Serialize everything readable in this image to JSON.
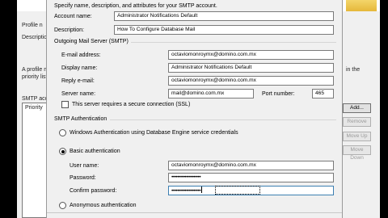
{
  "background_dialog": {
    "profile_name_label": "Profile n",
    "description_label": "Descriptio",
    "info_text_line1": "A profile m",
    "info_text_line2": "priority list",
    "info_text_right": "in the",
    "smtp_accounts_label": "SMTP acc",
    "list_header": "Priority",
    "buttons": {
      "add": "Add...",
      "remove": "Remove",
      "move_up": "Move Up",
      "move_down": "Move Down"
    }
  },
  "dialog": {
    "intro_text": "Specify name, description, and attributes for your SMTP account.",
    "account_name": {
      "label": "Account name:",
      "value": "Administrator Notifications Default"
    },
    "description": {
      "label": "Description:",
      "value": "How To Configure Database Mail"
    },
    "outgoing_section_title": "Outgoing Mail Server (SMTP)",
    "email_address": {
      "label": "E-mail address:",
      "value": "octaviomonroymx@domino.com.mx"
    },
    "display_name": {
      "label": "Display name:",
      "value": "Administrator Notifications Default"
    },
    "reply_email": {
      "label": "Reply e-mail:",
      "value": "octaviomonroymx@domino.com.mx"
    },
    "server_name": {
      "label": "Server name:",
      "value": "mail@domino.com.mx"
    },
    "port_number": {
      "label": "Port number:",
      "value": "465"
    },
    "ssl_checkbox": {
      "label": "This server requires a secure connection (SSL)",
      "checked": false
    },
    "auth_section_title": "SMTP Authentication",
    "auth_windows": {
      "label": "Windows Authentication using Database Engine service credentials",
      "selected": false
    },
    "auth_basic": {
      "label": "Basic authentication",
      "selected": true
    },
    "user_name": {
      "label": "User name:",
      "value": "octaviomonroymx@domino.com.mx"
    },
    "password": {
      "label": "Password:",
      "value": "••••••••••••••••••••"
    },
    "confirm_password": {
      "label": "Confirm password:",
      "value": "••••••••••••••••••••"
    },
    "auth_anonymous": {
      "label": "Anonymous authentication",
      "selected": false
    }
  },
  "colors": {
    "dialog_bg": "#f0f0f0",
    "field_border": "#7a7a7a",
    "focus_border": "#3c7fb1",
    "disabled_text": "#9a9a9a"
  }
}
